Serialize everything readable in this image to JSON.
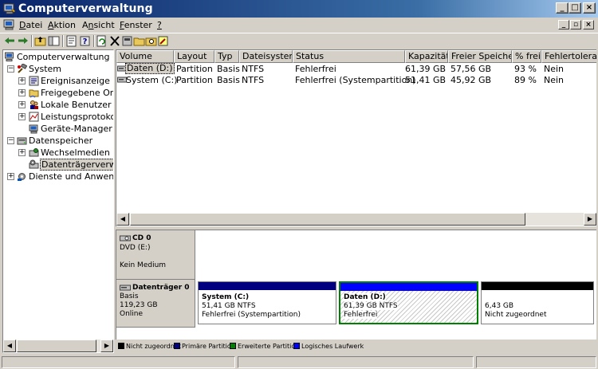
{
  "window": {
    "title": "Computerverwaltung"
  },
  "menu": [
    {
      "label": "Datei",
      "u": "D"
    },
    {
      "label": "Aktion",
      "u": "A"
    },
    {
      "label": "Ansicht",
      "u": "n"
    },
    {
      "label": "Fenster",
      "u": "F"
    },
    {
      "label": "?",
      "u": "?"
    }
  ],
  "tree": {
    "root": "Computerverwaltung (Lokal)",
    "system": "System",
    "system_children": [
      "Ereignisanzeige",
      "Freigegebene Ordner",
      "Lokale Benutzer und Gruppen",
      "Leistungsprotokolle und Warnungen",
      "Geräte-Manager"
    ],
    "storage": "Datenspeicher",
    "storage_children": [
      "Wechselmedien",
      "Datenträgerverwaltung"
    ],
    "services": "Dienste und Anwendungen"
  },
  "list": {
    "columns": [
      "Volume",
      "Layout",
      "Typ",
      "Dateisystem",
      "Status",
      "Kapazität",
      "Freier Speicher",
      "% frei",
      "Fehlertoleranz"
    ],
    "rows": [
      [
        "Daten (D:)",
        "Partition",
        "Basis",
        "NTFS",
        "Fehlerfrei",
        "61,39 GB",
        "57,56 GB",
        "93 %",
        "Nein"
      ],
      [
        "System (C:)",
        "Partition",
        "Basis",
        "NTFS",
        "Fehlerfrei (Systempartition)",
        "51,41 GB",
        "45,92 GB",
        "89 %",
        "Nein"
      ]
    ]
  },
  "disks": {
    "cd": {
      "title": "CD 0",
      "type": "DVD (E:)",
      "status": "Kein Medium"
    },
    "disk0": {
      "title": "Datenträger 0",
      "type": "Basis",
      "size": "119,23 GB",
      "status": "Online"
    },
    "partitions": [
      {
        "name": "System  (C:)",
        "size": "51,41 GB NTFS",
        "status": "Fehlerfrei (Systempartition)",
        "color": "#000080"
      },
      {
        "name": "Daten  (D:)",
        "size": "61,39 GB NTFS",
        "status": "Fehlerfrei",
        "color": "#0000ff"
      },
      {
        "name": "",
        "size": "6,43 GB",
        "status": "Nicht zugeordnet",
        "color": "#000000"
      }
    ]
  },
  "legend": [
    {
      "label": "Nicht zugeordnet",
      "color": "#000000"
    },
    {
      "label": "Primäre Partition",
      "color": "#000080"
    },
    {
      "label": "Erweiterte Partition",
      "color": "#008000"
    },
    {
      "label": "Logisches Laufwerk",
      "color": "#0000ff"
    }
  ],
  "colors": {
    "titlebar": "#0a246a",
    "selection_border": "#008000"
  },
  "icons": [
    "back-icon",
    "forward-icon",
    "up-icon",
    "show-tree-icon",
    "properties-icon",
    "help-icon",
    "refresh-icon",
    "delete-icon",
    "console-icon",
    "open-icon",
    "search-icon",
    "wizard-icon"
  ]
}
